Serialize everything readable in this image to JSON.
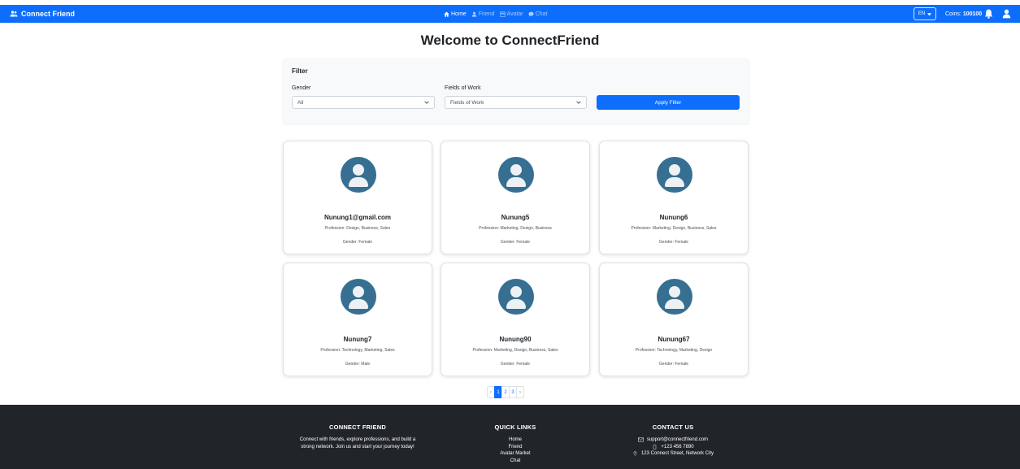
{
  "navbar": {
    "brand": "Connect Friend",
    "links": [
      {
        "label": "Home",
        "icon": "home-icon",
        "active": true
      },
      {
        "label": "Friend",
        "icon": "person-icon",
        "active": false
      },
      {
        "label": "Avatar",
        "icon": "store-icon",
        "active": false
      },
      {
        "label": "Chat",
        "icon": "chat-icon",
        "active": false
      }
    ],
    "language": "EN",
    "coins_label": "Coins:",
    "coins_value": "100100"
  },
  "page_title": "Welcome to ConnectFriend",
  "filter": {
    "heading": "Filter",
    "gender_label": "Gender",
    "gender_value": "All",
    "fields_label": "Fields of Work",
    "fields_value": "Fields of Work",
    "apply_label": "Apply Filter"
  },
  "friends": [
    {
      "name": "Nunung1@gmail.com",
      "profession": "Profession: Design, Business, Sales",
      "gender": "Gender: Female"
    },
    {
      "name": "Nunung5",
      "profession": "Profession: Marketing, Design, Business",
      "gender": "Gender: Female"
    },
    {
      "name": "Nunung6",
      "profession": "Profession: Marketing, Design, Business, Sales",
      "gender": "Gender: Female"
    },
    {
      "name": "Nunung7",
      "profession": "Profession: Technology, Marketing, Sales",
      "gender": "Gender: Male"
    },
    {
      "name": "Nunung90",
      "profession": "Profession: Marketing, Design, Business, Sales",
      "gender": "Gender: Female"
    },
    {
      "name": "Nunung67",
      "profession": "Profession: Technology, Marketing, Design",
      "gender": "Gender: Female"
    }
  ],
  "pagination": {
    "prev": "‹",
    "pages": [
      "1",
      "2",
      "3"
    ],
    "current": "1",
    "next": "›"
  },
  "footer": {
    "about_title": "CONNECT FRIEND",
    "about_line1": "Connect with friends, explore professions, and build a",
    "about_line2": "strong network. Join us and start your journey today!",
    "links_title": "QUICK LINKS",
    "links": [
      "Home",
      "Friend",
      "Avatar Market",
      "Chat"
    ],
    "contact_title": "CONTACT US",
    "email": "support@connectfriend.com",
    "phone": "+123 456 7890",
    "address": "123 Connect Street, Network City"
  },
  "colors": {
    "primary": "#0d6efd",
    "avatar_bg": "#366f91",
    "footer_bg": "#212529",
    "filter_bg": "#f8f9fa"
  }
}
